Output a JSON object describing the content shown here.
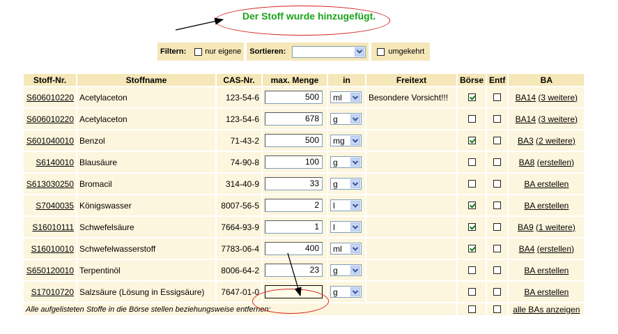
{
  "message": "Der Stoff wurde hinzugefügt.",
  "filter": {
    "label": "Filtern:",
    "option": "nur eigene"
  },
  "sort": {
    "label": "Sortieren:",
    "value": "",
    "reverse_label": "umgekehrt"
  },
  "headers": [
    "Stoff-Nr.",
    "Stoffname",
    "CAS-Nr.",
    "max. Menge",
    "in",
    "Freitext",
    "Börse",
    "Entf",
    "BA"
  ],
  "rows": [
    {
      "code": "S606010220",
      "name": "Acetylaceton",
      "cas": "123-54-6",
      "qty": "500",
      "unit": "ml",
      "note": "Besondere Vorsicht!!!",
      "boerse": true,
      "entf": false,
      "ba": "BA14",
      "ba_more": "(3 weitere)"
    },
    {
      "code": "S606010220",
      "name": "Acetylaceton",
      "cas": "123-54-6",
      "qty": "678",
      "unit": "g",
      "note": "",
      "boerse": false,
      "entf": false,
      "ba": "BA14",
      "ba_more": "(3 weitere)"
    },
    {
      "code": "S601040010",
      "name": "Benzol",
      "cas": "71-43-2",
      "qty": "500",
      "unit": "mg",
      "note": "",
      "boerse": true,
      "entf": false,
      "ba": "BA3",
      "ba_more": "(2 weitere)"
    },
    {
      "code": "S6140010",
      "name": "Blausäure",
      "cas": "74-90-8",
      "qty": "100",
      "unit": "g",
      "note": "",
      "boerse": false,
      "entf": false,
      "ba": "BA8",
      "ba_more": "(erstellen)"
    },
    {
      "code": "S613030250",
      "name": "Bromacil",
      "cas": "314-40-9",
      "qty": "33",
      "unit": "g",
      "note": "",
      "boerse": false,
      "entf": false,
      "ba": "BA erstellen",
      "ba_more": ""
    },
    {
      "code": "S7040035",
      "name": "Königswasser",
      "cas": "8007-56-5",
      "qty": "2",
      "unit": "l",
      "note": "",
      "boerse": true,
      "entf": false,
      "ba": "BA erstellen",
      "ba_more": ""
    },
    {
      "code": "S16010111",
      "name": "Schwefelsäure",
      "cas": "7664-93-9",
      "qty": "1",
      "unit": "l",
      "note": "",
      "boerse": true,
      "entf": false,
      "ba": "BA9",
      "ba_more": "(1 weitere)"
    },
    {
      "code": "S16010010",
      "name": "Schwefelwasserstoff",
      "cas": "7783-06-4",
      "qty": "400",
      "unit": "ml",
      "note": "",
      "boerse": true,
      "entf": false,
      "ba": "BA4",
      "ba_more": "(erstellen)"
    },
    {
      "code": "S650120010",
      "name": "Terpentinöl",
      "cas": "8006-64-2",
      "qty": "23",
      "unit": "g",
      "note": "",
      "boerse": false,
      "entf": false,
      "ba": "BA erstellen",
      "ba_more": ""
    },
    {
      "code": "S17010720",
      "name": "Salzsäure (Lösung in Essigsäure)",
      "cas": "7647-01-0",
      "qty": "",
      "unit": "g",
      "note": "",
      "boerse": false,
      "entf": false,
      "ba": "BA erstellen",
      "ba_more": "",
      "active": true
    }
  ],
  "footer": {
    "text": "Alle aufgelisteten Stoffe in die Börse stellen beziehungsweise entfernen:",
    "link": "alle BAs anzeigen"
  },
  "colors": {
    "header_bg": "#f5e7b8",
    "cell_bg": "#fdf6de",
    "message": "#1aa31a",
    "annotation": "#d42020"
  }
}
